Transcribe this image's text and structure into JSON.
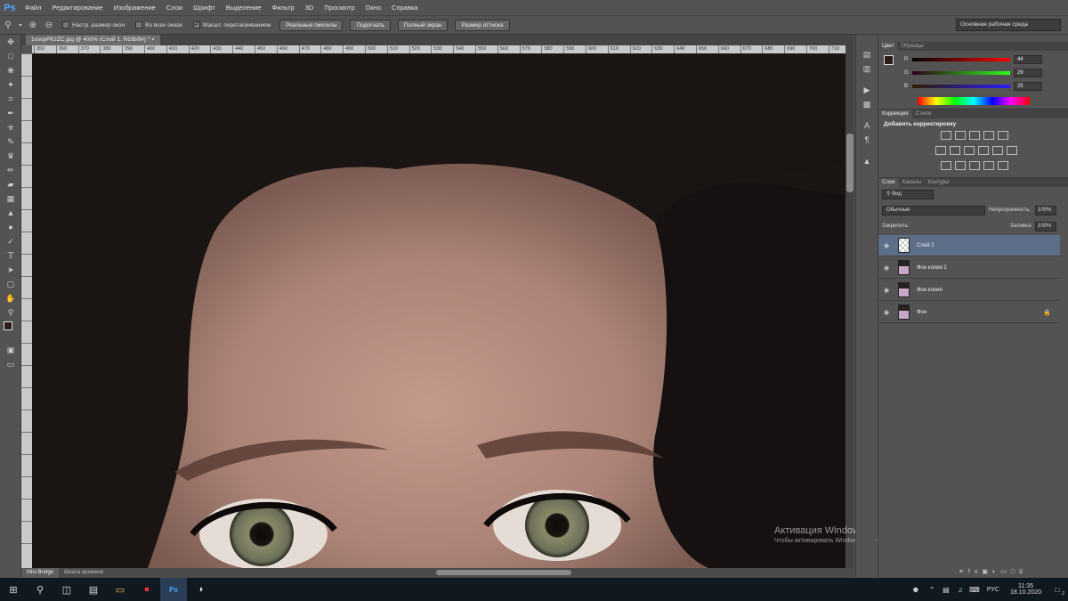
{
  "app": {
    "logo": "Ps"
  },
  "menu": [
    "Файл",
    "Редактирование",
    "Изображение",
    "Слои",
    "Шрифт",
    "Выделение",
    "Фильтр",
    "3D",
    "Просмотр",
    "Окно",
    "Справка"
  ],
  "options": {
    "check1": "Настр. размер окон",
    "check2": "Во всех окнах",
    "check3": "Масшт. перетаскиванием",
    "btn1": "Реальные пикселы",
    "btn2": "Подогнать",
    "btn3": "Полный экран",
    "btn4": "Размер оттиска",
    "workspace": "Основная рабочая среда"
  },
  "document": {
    "tab_title": "1vsoyPKzZC.jpg @ 400% (Слой 1, RGB/8#) *"
  },
  "ruler": [
    "350",
    "360",
    "370",
    "380",
    "390",
    "400",
    "410",
    "420",
    "430",
    "440",
    "450",
    "460",
    "470",
    "480",
    "490",
    "500",
    "510",
    "520",
    "530",
    "540",
    "550",
    "560",
    "570",
    "580",
    "590",
    "600",
    "610",
    "620",
    "630",
    "640",
    "650",
    "660",
    "670",
    "680",
    "690",
    "700",
    "710"
  ],
  "bottom_tabs": [
    "Mini Bridge",
    "Шкала времени"
  ],
  "color_panel": {
    "tabs": [
      "Цвет",
      "Образцы"
    ],
    "r": {
      "label": "R",
      "value": "44"
    },
    "g": {
      "label": "G",
      "value": "29"
    },
    "b": {
      "label": "B",
      "value": "25"
    },
    "fg_color": "#2c1d19",
    "bg_color": "#c99a94"
  },
  "adjust_panel": {
    "tabs": [
      "Коррекция",
      "Стили"
    ],
    "title": "Добавить корректировку"
  },
  "layers_panel": {
    "tabs": [
      "Слои",
      "Каналы",
      "Контуры"
    ],
    "filter": "Вид",
    "blend_mode": "Обычные",
    "opacity_label": "Непрозрачность:",
    "opacity": "100%",
    "lock_label": "Закрепить:",
    "fill_label": "Заливка:",
    "fill": "100%",
    "layers": [
      {
        "name": "Слой 1",
        "selected": true
      },
      {
        "name": "Фон копия 2",
        "selected": false
      },
      {
        "name": "Фон копия",
        "selected": false
      },
      {
        "name": "Фон",
        "selected": false
      }
    ]
  },
  "watermark": {
    "title": "Активация Windows",
    "text": "Чтобы активировать Windows, перейдите в раздел \"Параметры\"."
  },
  "taskbar": {
    "lang": "РУС",
    "time": "11:35",
    "date": "18.10.2020",
    "notif": "2"
  }
}
